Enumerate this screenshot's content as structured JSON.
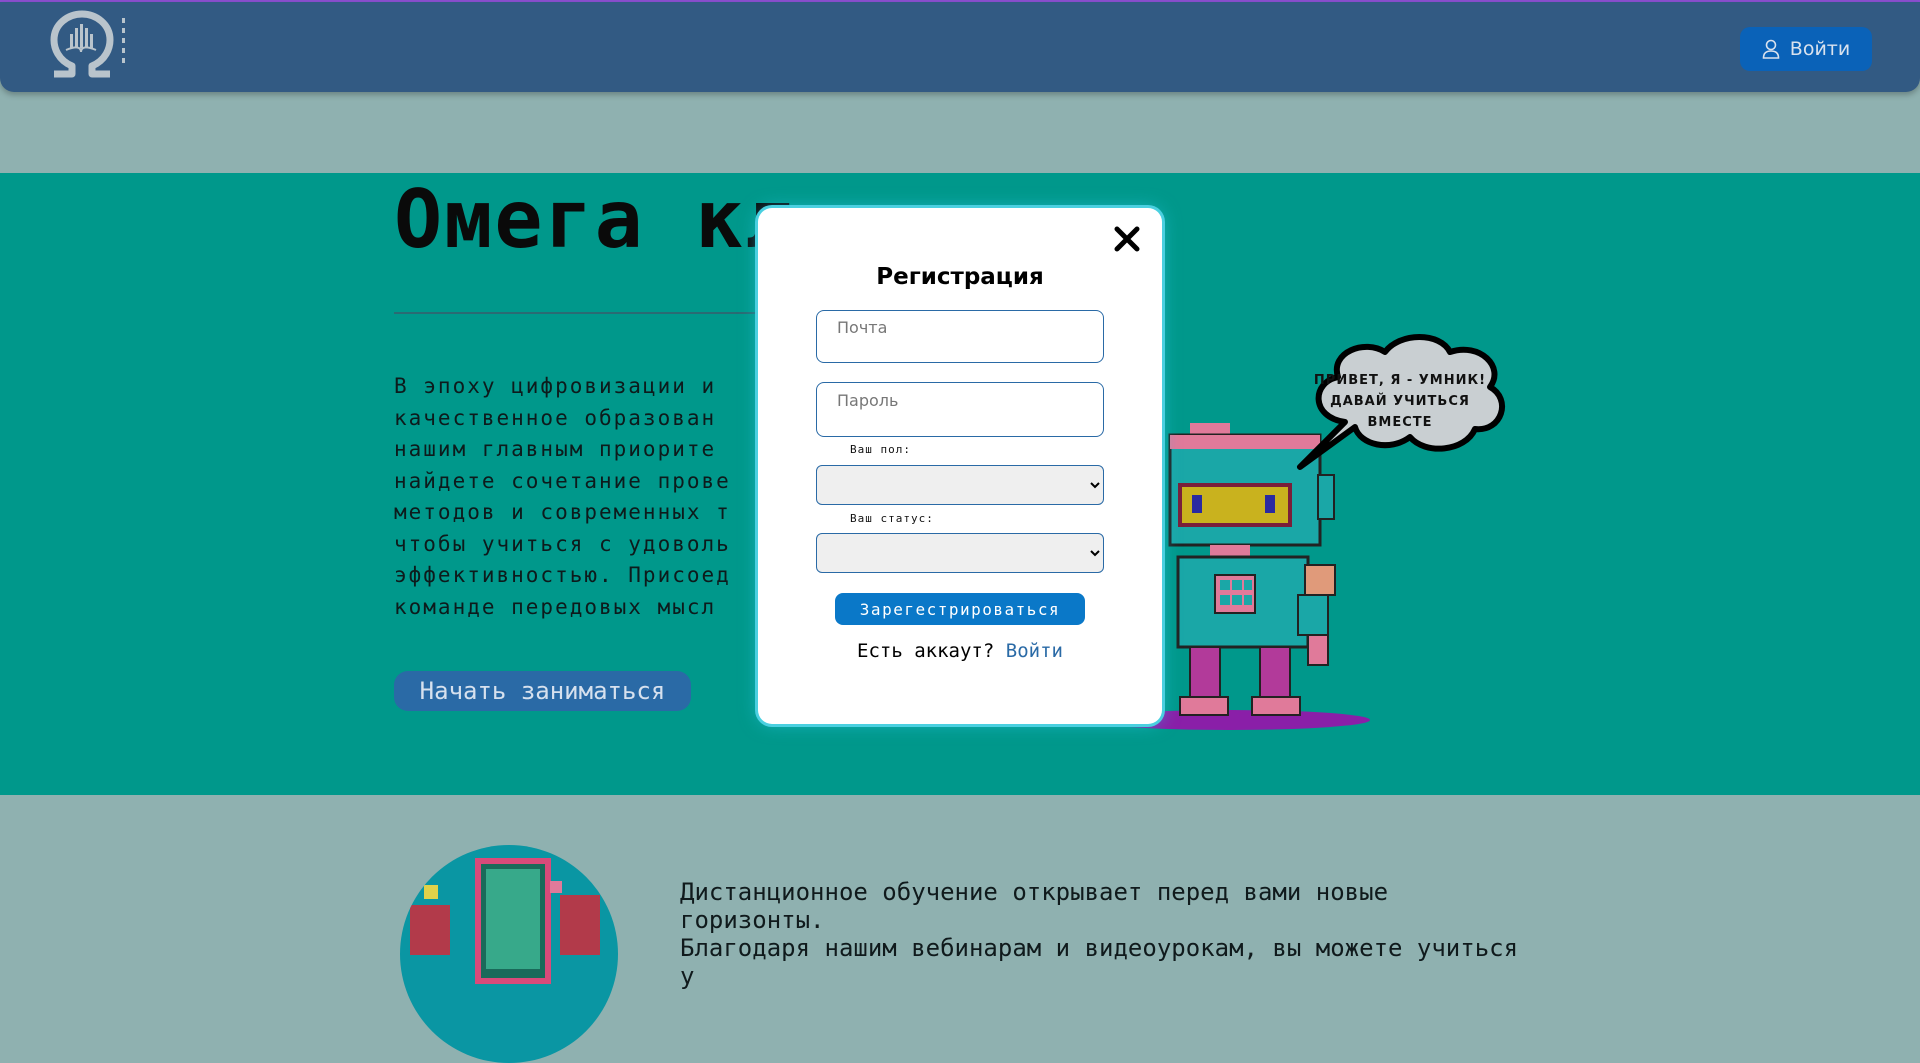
{
  "header": {
    "login_label": "Войти",
    "login_icon": "user-icon",
    "logo_icon": "omega-logo"
  },
  "hero": {
    "title": "Омега кл",
    "text": "В эпоху цифровизации и\nкачественное образован\nнашим главным приорите\nнайдете сочетание прове\nметодов и современных т\nчтобы учиться с удоволь\nэффективностью. Присоед\nкоманде передовых мысл",
    "start_button": "Начать заниматься"
  },
  "mascot": {
    "speech": "ПРИВЕТ, Я - УМНИК!\nДАВАЙ УЧИТЬСЯ\nВМЕСТЕ"
  },
  "about": {
    "text": "Дистанционное обучение открывает перед вами новые горизонты.\nБлагодаря нашим вебинарам и видеоурокам, вы можете учиться у"
  },
  "modal": {
    "title": "Регистрация",
    "email_placeholder": "Почта",
    "password_placeholder": "Пароль",
    "gender_label": "Ваш пол:",
    "status_label": "Ваш статус:",
    "gender_value": "",
    "status_value": "",
    "register_button": "Зарегестрироваться",
    "have_account_text": "Есть аккаут?",
    "login_link": "Войти"
  },
  "colors": {
    "header_bg": "#325a83",
    "hero_bg": "#00988b",
    "page_bg": "#8fb1b0",
    "accent": "#0a78c8"
  }
}
